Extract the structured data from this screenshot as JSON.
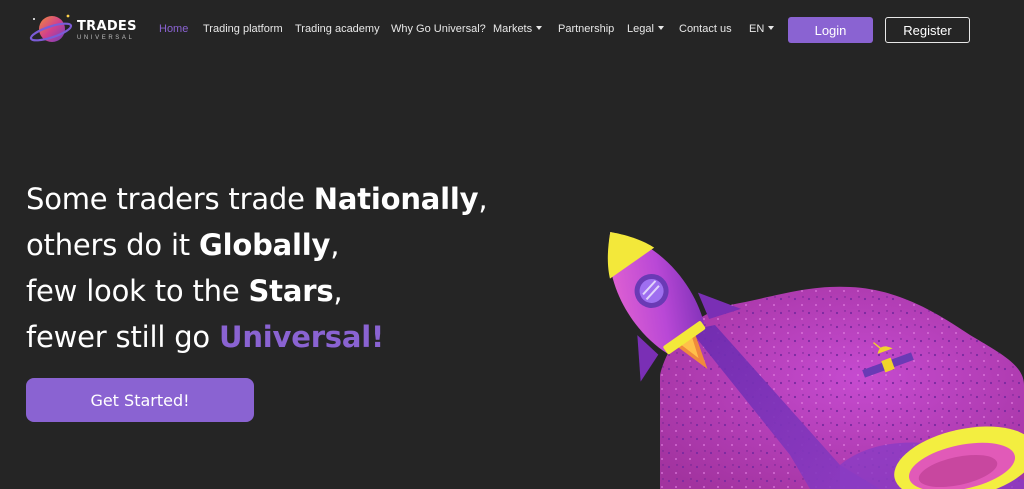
{
  "brand": {
    "title": "TRADES",
    "subtitle": "UNIVERSAL"
  },
  "nav": {
    "items": [
      {
        "label": "Home",
        "active": true
      },
      {
        "label": "Trading platform"
      },
      {
        "label": "Trading academy"
      },
      {
        "label": "Why Go Universal?"
      },
      {
        "label": "Markets",
        "dropdown": true
      },
      {
        "label": "Partnership"
      },
      {
        "label": "Legal",
        "dropdown": true
      },
      {
        "label": "Contact us"
      },
      {
        "label": "EN",
        "dropdown": true
      }
    ],
    "login_label": "Login",
    "register_label": "Register"
  },
  "hero": {
    "line1_a": "Some traders trade ",
    "line1_b": "Nationally",
    "line1_c": ",",
    "line2_a": "others do it ",
    "line2_b": "Globally",
    "line2_c": ",",
    "line3_a": "few look to the ",
    "line3_b": "Stars",
    "line3_c": ",",
    "line4_a": "fewer still go ",
    "line4_b": "Universal!",
    "cta_label": "Get Started!"
  },
  "colors": {
    "accent": "#8a63d2",
    "background": "#252525",
    "planet": "#b23fc4",
    "ring": "#f5f042"
  },
  "icons": {
    "logo": "planet-logo-icon",
    "illustration": "rocket-illustration"
  }
}
